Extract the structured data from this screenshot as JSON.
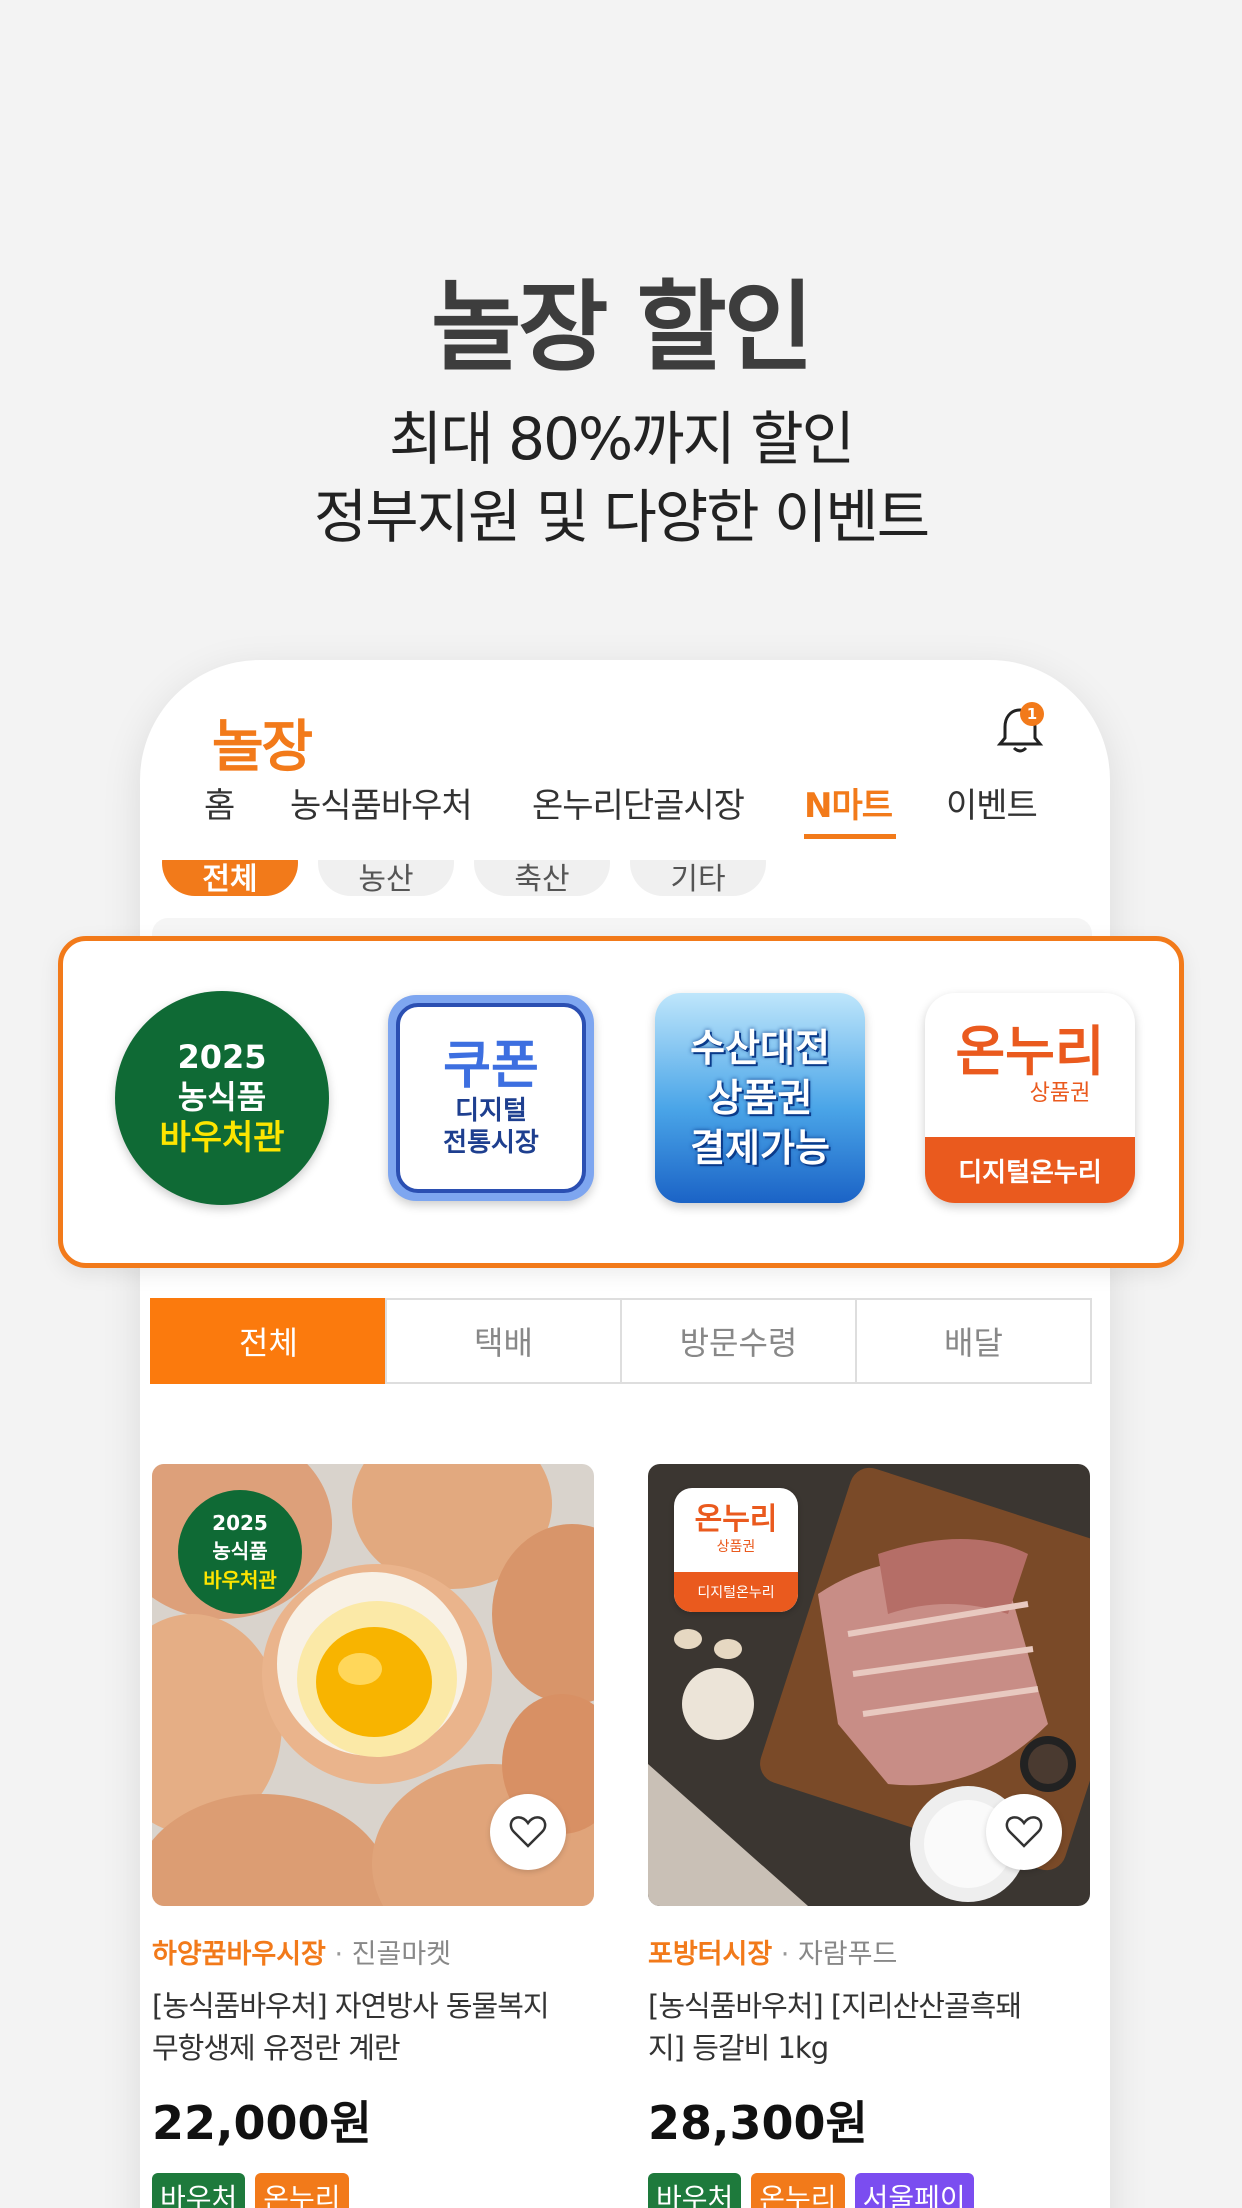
{
  "hero": {
    "title": "놀장 할인",
    "line1": "최대 80%까지 할인",
    "line2": "정부지원 및 다양한 이벤트"
  },
  "app": {
    "logo": "놀장",
    "notification_count": "1",
    "accent_color": "#f27a1a"
  },
  "nav": {
    "items": [
      "홈",
      "농식품바우처",
      "온누리단골시장",
      "N마트",
      "이벤트"
    ],
    "active": "N마트"
  },
  "chips": [
    "전체",
    "농산",
    "축산",
    "기타"
  ],
  "highlight": {
    "items": [
      {
        "lines": [
          "2025",
          "농식품",
          "바우처관"
        ],
        "icon": "voucher-badge-icon"
      },
      {
        "lines": [
          "쿠폰",
          "디지털",
          "전통시장"
        ],
        "icon": "coupon-icon"
      },
      {
        "lines": [
          "수산대전",
          "상품권",
          "결제가능"
        ],
        "icon": "seafood-voucher-icon"
      },
      {
        "lines": [
          "온누리",
          "상품권",
          "디지털온누리"
        ],
        "icon": "onnuri-icon"
      }
    ]
  },
  "filter_tabs": [
    "전체",
    "택배",
    "방문수령",
    "배달"
  ],
  "products": [
    {
      "market": "하양꿈바우시장",
      "seller": "진골마켓",
      "name_line1": "[농식품바우처] 자연방사 동물복지",
      "name_line2": "무항생제 유정란 계란",
      "price": "22,000원",
      "badge": [
        "2025",
        "농식품",
        "바우처관"
      ],
      "tags": [
        {
          "label": "바우처",
          "color": "#1e7a3c"
        },
        {
          "label": "온누리",
          "color": "#f27a1a"
        }
      ]
    },
    {
      "market": "포방터시장",
      "seller": "자람푸드",
      "name_line1": "[농식품바우처] [지리산산골흑돼",
      "name_line2": "지] 등갈비 1kg",
      "price": "28,300원",
      "badge": [
        "온누리",
        "상품권",
        "디지털온누리"
      ],
      "tags": [
        {
          "label": "바우처",
          "color": "#1e7a3c"
        },
        {
          "label": "온누리",
          "color": "#f27a1a"
        },
        {
          "label": "서울페이",
          "color": "#7b4df0"
        }
      ]
    }
  ]
}
